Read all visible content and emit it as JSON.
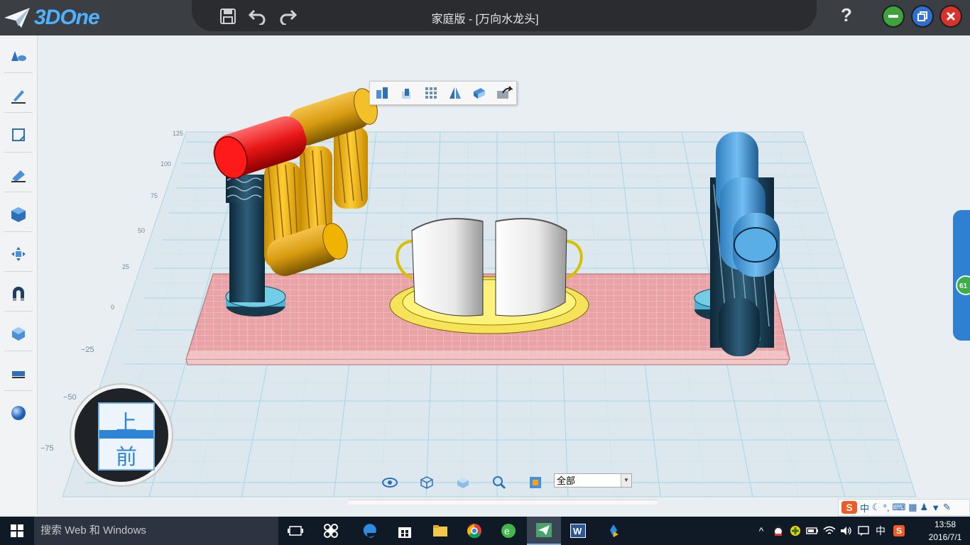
{
  "app": {
    "logo_text": "3DOne",
    "window_title": "家庭版 - [万向水龙头]",
    "help_label": "?",
    "accent_color": "#2e84d6"
  },
  "titlebar": {
    "icons": [
      "save-icon",
      "undo-icon",
      "redo-icon"
    ],
    "window_buttons": [
      "minimize-icon",
      "restore-icon",
      "close-icon"
    ]
  },
  "sidebar": {
    "tools": [
      {
        "icon": "basic-solid-icon"
      },
      {
        "icon": "sketch-icon"
      },
      {
        "icon": "sketch-edit-icon"
      },
      {
        "icon": "feature-icon"
      },
      {
        "icon": "special-function-icon"
      },
      {
        "icon": "transform-icon"
      },
      {
        "icon": "assembly-icon"
      },
      {
        "icon": "combine-icon"
      },
      {
        "icon": "measure-icon"
      },
      {
        "icon": "render-color-icon"
      }
    ]
  },
  "float_toolbar": {
    "icons": [
      "align-icon",
      "extrude-icon",
      "array-icon",
      "mirror-icon",
      "shell-icon",
      "export-icon"
    ]
  },
  "grid_labels": {
    "y_values": [
      "125",
      "100",
      "75",
      "50",
      "25",
      "0",
      "−25",
      "−50",
      "−75"
    ]
  },
  "viewcube": {
    "top_label": "上",
    "front_label": "前"
  },
  "bottom_toolbar": {
    "icons": [
      "view-eye-icon",
      "wireframe-icon",
      "shaded-icon",
      "zoom-icon",
      "fit-view-icon"
    ],
    "filter_value": "全部"
  },
  "side_handle": {
    "badge": "61"
  },
  "ime": {
    "logo": "S",
    "mode": "中",
    "icons": [
      "moon-icon",
      "punctuation-icon",
      "keyboard-icon",
      "grid-icon",
      "user-icon",
      "skin-icon",
      "wrench-icon"
    ]
  },
  "taskbar": {
    "search_placeholder": "搜索 Web 和 Windows",
    "apps": [
      "task-view-icon",
      "fan-app-icon",
      "edge-icon",
      "store-icon",
      "explorer-icon",
      "chrome-icon",
      "browser-360-icon",
      "3done-icon",
      "word-icon",
      "maple-icon"
    ],
    "tray_lang": "中",
    "time": "13:58",
    "date": "2016/7/1"
  }
}
